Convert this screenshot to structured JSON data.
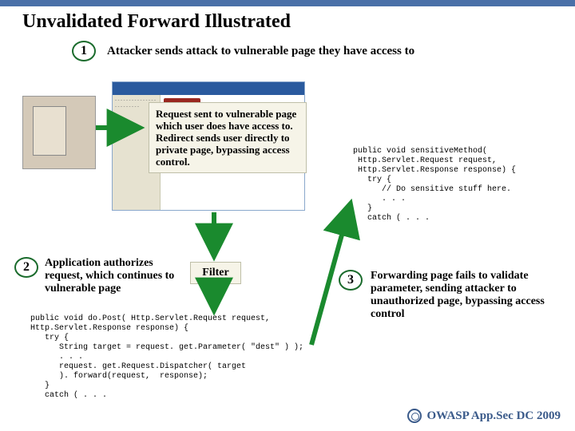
{
  "title": "Unvalidated Forward Illustrated",
  "steps": {
    "s1": {
      "num": "1",
      "label": "Attacker sends attack to vulnerable page they have access to"
    },
    "s2": {
      "num": "2",
      "label": "Application authorizes request, which continues to vulnerable page"
    },
    "s3": {
      "num": "3",
      "label": "Forwarding page fails to validate parameter, sending attacker to unauthorized page, bypassing access control"
    }
  },
  "callout": "Request sent to vulnerable page which user does have access to. Redirect sends user directly to private page, bypassing access control.",
  "filter_label": "Filter",
  "code_right": "public void sensitiveMethod(\n Http.Servlet.Request request,\n Http.Servlet.Response response) {\n   try {\n      // Do sensitive stuff here.\n      . . .\n   }\n   catch ( . . .",
  "code_bottom": "public void do.Post( Http.Servlet.Request request,\nHttp.Servlet.Response response) {\n   try {\n      String target = request. get.Parameter( \"dest\" ) );\n      . . .\n      request. get.Request.Dispatcher( target\n      ). forward(request,  response);\n   }\n   catch ( . . .",
  "footer": "OWASP App.Sec DC 2009",
  "browser_side_text": "- - - -\n- - - -\n- - - -\n- - - -\n- - - -\n- - - -"
}
